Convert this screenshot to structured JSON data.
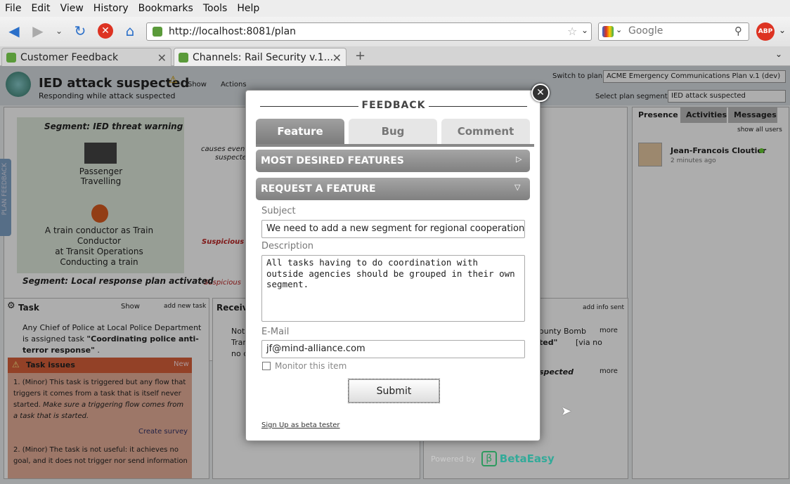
{
  "menubar": [
    "File",
    "Edit",
    "View",
    "History",
    "Bookmarks",
    "Tools",
    "Help"
  ],
  "nav": {
    "url": "http://localhost:8081/plan",
    "search_placeholder": "Google",
    "adblock": "ABP"
  },
  "tabs": [
    {
      "label": "Customer Feedback"
    },
    {
      "label": "Channels: Rail Security v.1..."
    }
  ],
  "plan": {
    "title": "IED attack suspected",
    "subtitle": "Responding while attack suspected",
    "show": "Show",
    "actions": "Actions",
    "switch_label": "Switch to plan:",
    "switch_value": "ACME Emergency Communications Plan v.1 (dev)",
    "segment_label": "Select plan segment:",
    "segment_value": "IED attack suspected"
  },
  "graph": {
    "segment1": "Segment: IED threat warning",
    "node1": "Passenger Travelling",
    "node2_a": "A train conductor as Train Conductor",
    "node2_b": "at Transit Operations",
    "node2_c": "Conducting a train",
    "edge1": "causes event",
    "edge1b": "suspecte",
    "edge2": "Suspicious ba",
    "edge3": "Suspicious ",
    "segment2": "Segment: Local response plan activated",
    "side_tab": "PLAN FEEDBACK"
  },
  "task": {
    "title": "Task",
    "show": "Show",
    "add": "add new task",
    "desc_a": "Any Chief of Police at Local Police Department is assigned task ",
    "desc_b": "\"Coordinating police anti-terror response\"",
    "desc_c": " .",
    "issues_title": "Task issues",
    "issues_new": "New",
    "issue1_a": "1.  (Minor) This task is triggered but any flow that triggers it comes from a task that is itself never started. ",
    "issue1_b": "Make sure a triggering flow comes from a task that is started.",
    "create_survey": "Create survey",
    "issue2": "2.  (Minor) The task is not useful: it achieves no goal, and it does not trigger nor send information"
  },
  "received": {
    "title": "Receiv",
    "n1": "Notif",
    "n2": "Tran",
    "n3": "no c"
  },
  "sent": {
    "add": "add info sent",
    "l1": "ounty Bomb",
    "l1b": "ted\"",
    "l1c": "[via no",
    "l2": "spected",
    "more": "more"
  },
  "presence": {
    "tabs": [
      "Presence",
      "Activities",
      "Messages"
    ],
    "show_all": "show all users",
    "user": "Jean-Francois Cloutier",
    "time": "2 minutes ago"
  },
  "feedback": {
    "title": "FEEDBACK",
    "tabs": [
      "Feature",
      "Bug",
      "Comment"
    ],
    "most_desired": "MOST DESIRED FEATURES",
    "request": "REQUEST A FEATURE",
    "subject_label": "Subject",
    "subject_value": "We need to add a new segment for regional cooperation",
    "description_label": "Description",
    "description_value": "All tasks having to do coordination with outside agencies should be grouped in their own segment.",
    "email_label": "E-Mail",
    "email_value": "jf@mind-alliance.com",
    "monitor_label": "Monitor this item",
    "submit": "Submit",
    "signup": "Sign Up as beta tester"
  },
  "powered": {
    "label": "Powered by",
    "brand": "BetaEasy"
  },
  "colors": {
    "accent": "#2d9a5e",
    "issues_bg": "#e8b09a",
    "issues_header": "#d9603a"
  }
}
